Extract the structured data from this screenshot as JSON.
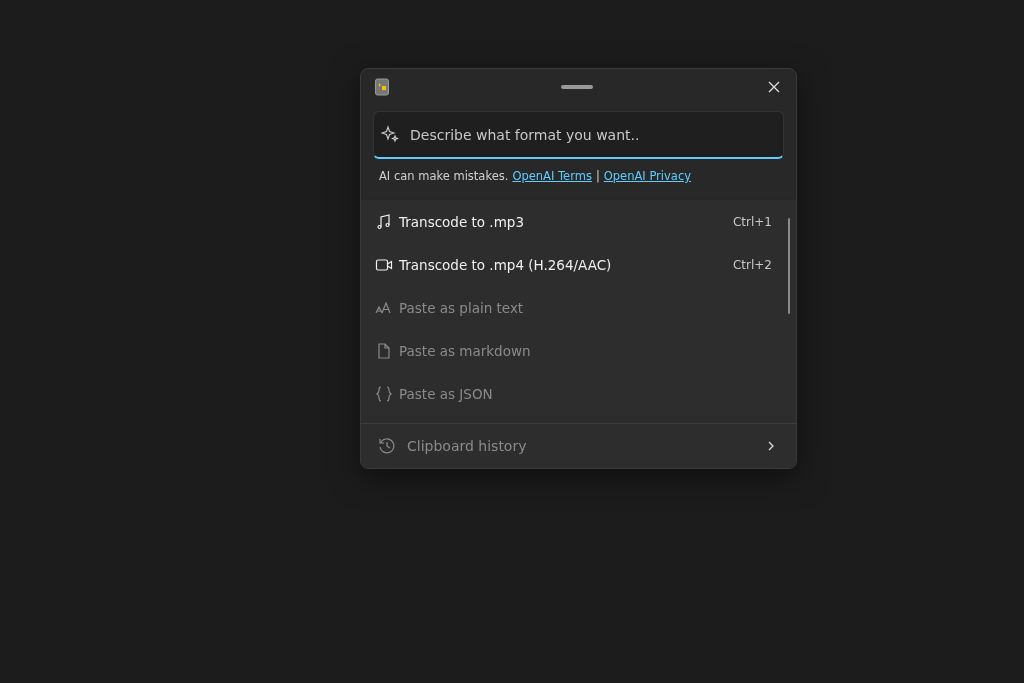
{
  "search": {
    "placeholder": "Describe what format you want.."
  },
  "disclaimer": {
    "text": "AI can make mistakes.",
    "links": [
      {
        "label": "OpenAI Terms"
      },
      {
        "label": "OpenAI Privacy"
      }
    ],
    "separator": "|"
  },
  "actions": [
    {
      "kind": "audio",
      "label": "Transcode to .mp3",
      "shortcut": "Ctrl+1",
      "disabled": false
    },
    {
      "kind": "video",
      "label": "Transcode to .mp4 (H.264/AAC)",
      "shortcut": "Ctrl+2",
      "disabled": false
    },
    {
      "kind": "text",
      "label": "Paste as plain text",
      "disabled": true
    },
    {
      "kind": "document",
      "label": "Paste as markdown",
      "disabled": true
    },
    {
      "kind": "json",
      "label": "Paste as JSON",
      "disabled": true
    }
  ],
  "footer": {
    "label": "Clipboard history",
    "disabled": true
  }
}
